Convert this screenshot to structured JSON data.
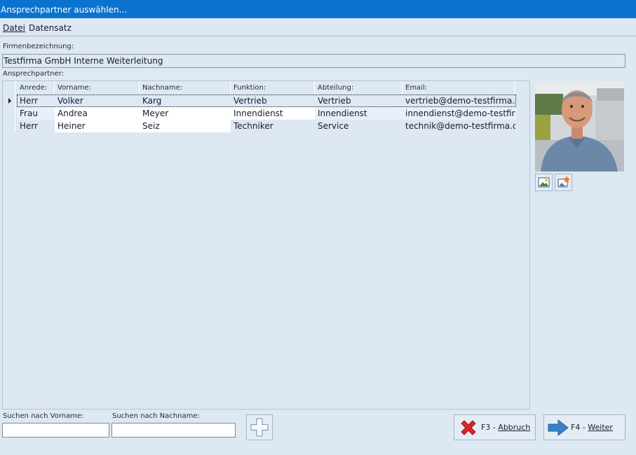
{
  "window": {
    "title": "Ansprechpartner auswählen..."
  },
  "menu": {
    "items": [
      {
        "label": "Datei"
      },
      {
        "label": "Datensatz"
      }
    ]
  },
  "company": {
    "label": "Firmenbezeichnung:",
    "value": "Testfirma GmbH Interne Weiterleitung"
  },
  "contacts": {
    "label": "Ansprechpartner:",
    "columns": [
      "Anrede:",
      "Vorname:",
      "Nachname:",
      "Funktion:",
      "Abteilung:",
      "Email:"
    ],
    "rows": [
      [
        "Herr",
        "Volker",
        "Karg",
        "Vertrieb",
        "Vertrieb",
        "vertrieb@demo-testfirma.de"
      ],
      [
        "Frau",
        "Andrea",
        "Meyer",
        "Innendienst",
        "Innendienst",
        "innendienst@demo-testfirm"
      ],
      [
        "Herr",
        "Heiner",
        "Seiz",
        "Techniker",
        "Service",
        "technik@demo-testfirma.de"
      ]
    ],
    "selected_row": 0
  },
  "search": {
    "firstname_label": "Suchen nach Vorname:",
    "firstname_value": "",
    "lastname_label": "Suchen nach Nachname:",
    "lastname_value": ""
  },
  "buttons": {
    "cancel_key": "F3 - ",
    "cancel_label": "Abbruch",
    "next_key": "F4 - ",
    "next_label": "Weiter"
  },
  "colors": {
    "titlebar": "#0a72cf",
    "background": "#dde8f3",
    "cancel_icon": "#d9262b",
    "next_icon": "#3a82c8"
  },
  "icons": {
    "photo_button": "image-icon",
    "photo_edit_button": "image-edit-icon",
    "add_button": "plus-icon",
    "cancel_button": "close-x-icon",
    "next_button": "arrow-right-icon",
    "row_indicator": "triangle-right-icon"
  }
}
